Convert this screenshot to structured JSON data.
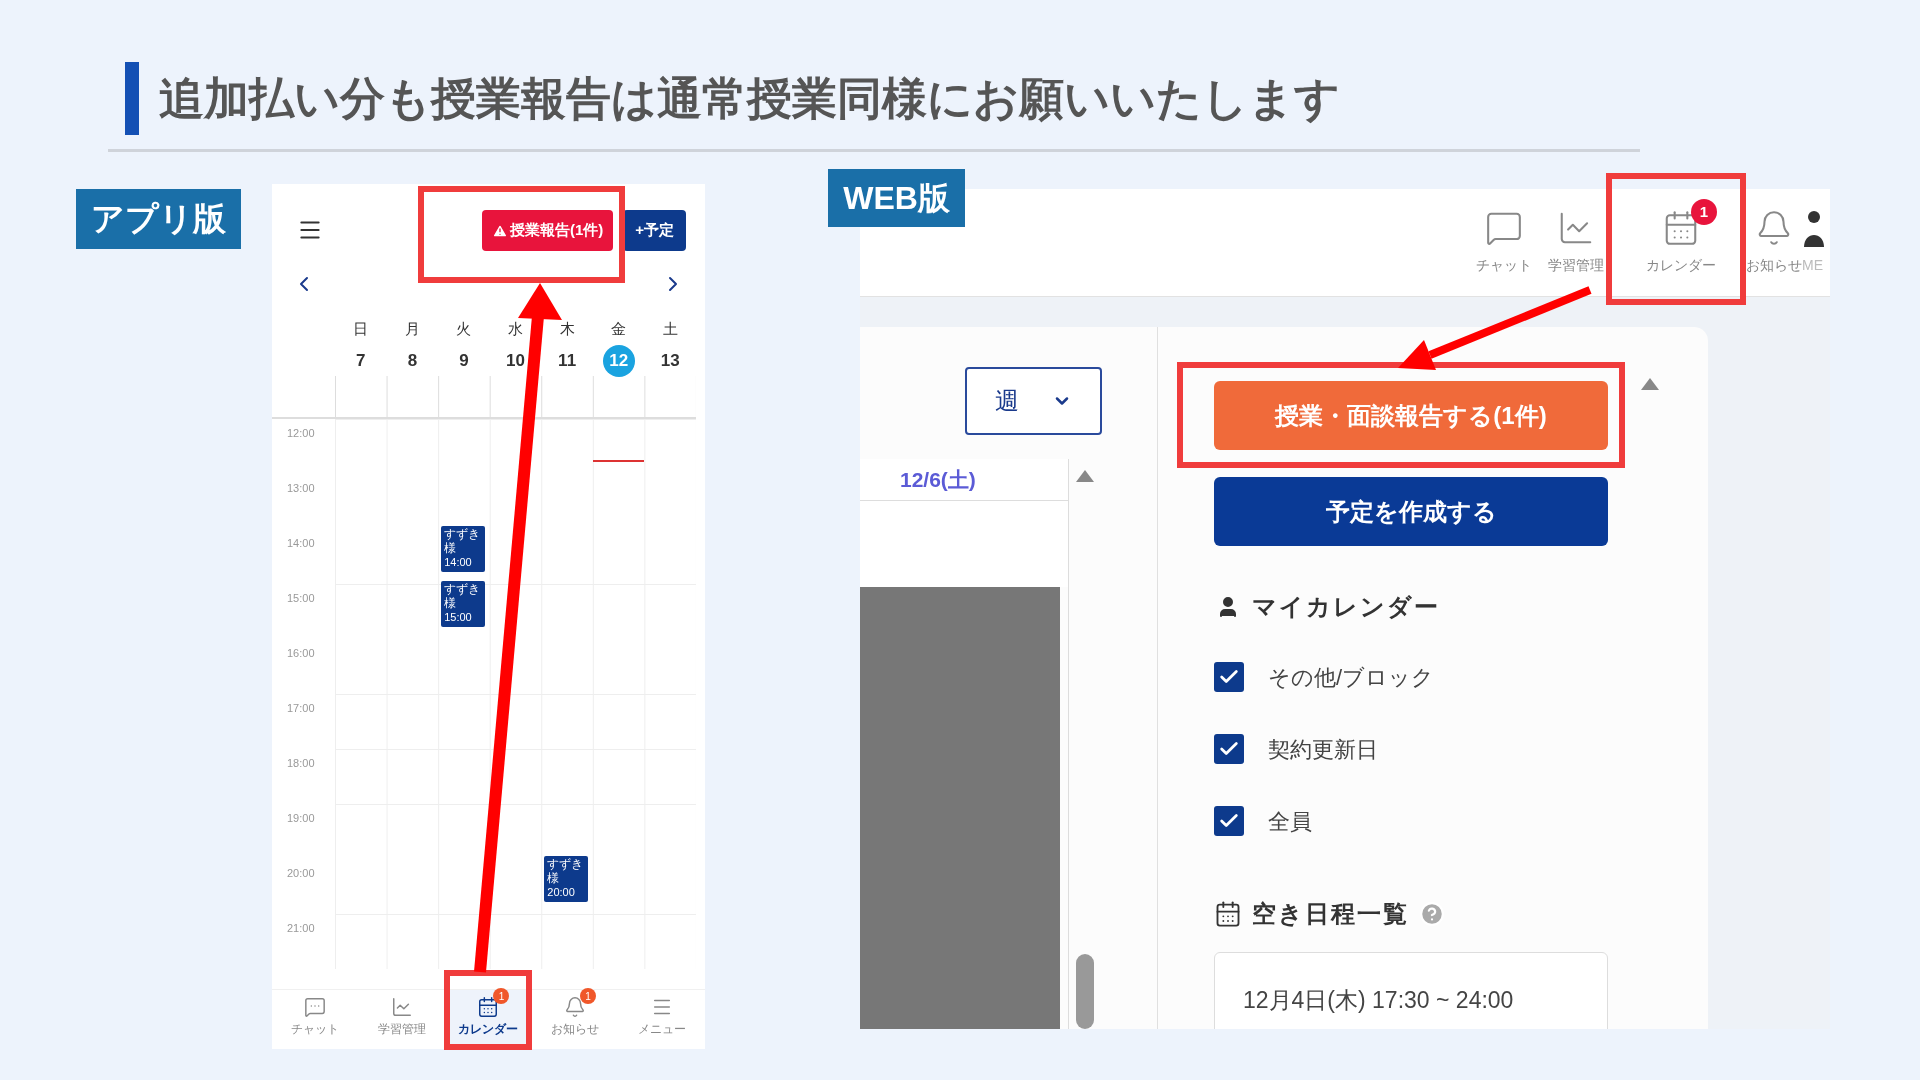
{
  "slide": {
    "title": "追加払い分も授業報告は通常授業同様にお願いいたします"
  },
  "app": {
    "label": "アプリ版",
    "report_button": "授業報告(1件)",
    "add_button": "+予定",
    "days": [
      {
        "weekday": "日",
        "date": "7",
        "selected": false
      },
      {
        "weekday": "月",
        "date": "8",
        "selected": false
      },
      {
        "weekday": "火",
        "date": "9",
        "selected": false,
        "events": [
          {
            "title": "すずき様",
            "time": "14:00"
          },
          {
            "title": "すずき様",
            "time": "15:00"
          }
        ]
      },
      {
        "weekday": "水",
        "date": "10",
        "selected": false
      },
      {
        "weekday": "木",
        "date": "11",
        "selected": false,
        "events": [
          {
            "title": "すずき様",
            "time": "20:00"
          }
        ]
      },
      {
        "weekday": "金",
        "date": "12",
        "selected": true
      },
      {
        "weekday": "土",
        "date": "13",
        "selected": false
      }
    ],
    "hours": [
      "12:00",
      "13:00",
      "14:00",
      "15:00",
      "16:00",
      "17:00",
      "18:00",
      "19:00",
      "20:00",
      "21:00"
    ],
    "nav": [
      {
        "kind": "chat",
        "label": "チャット",
        "selected": false
      },
      {
        "kind": "chart",
        "label": "学習管理",
        "selected": false
      },
      {
        "kind": "calendar",
        "label": "カレンダー",
        "selected": true,
        "badge": "1"
      },
      {
        "kind": "bell",
        "label": "お知らせ",
        "selected": false,
        "badge": "1"
      },
      {
        "kind": "menu",
        "label": "メニュー",
        "selected": false
      }
    ]
  },
  "web": {
    "label": "WEB版",
    "nav": [
      {
        "kind": "chat",
        "label": "チャット"
      },
      {
        "kind": "chart",
        "label": "学習管理"
      },
      {
        "kind": "calendar",
        "label": "カレンダー",
        "badge": "1"
      },
      {
        "kind": "bell",
        "label": "お知らせ"
      },
      {
        "kind": "avatar",
        "label": "ME"
      }
    ],
    "view_select": {
      "value": "週"
    },
    "date_header": "12/6(土)",
    "report_button": "授業・面談報告する(1件)",
    "create_button": "予定を作成する",
    "my_calendar": {
      "title": "マイカレンダー",
      "items": [
        {
          "label": "その他/ブロック",
          "checked": true
        },
        {
          "label": "契約更新日",
          "checked": true
        },
        {
          "label": "全員",
          "checked": true
        }
      ]
    },
    "free_slots": {
      "title": "空き日程一覧",
      "items": [
        "12月4日(木) 17:30 ~ 24:00"
      ]
    }
  }
}
